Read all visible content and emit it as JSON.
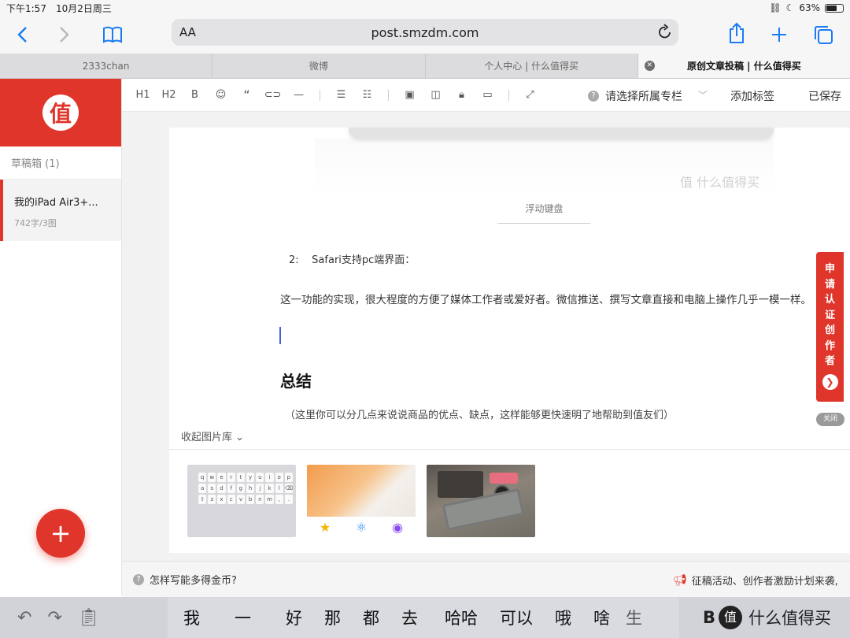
{
  "status_bar": {
    "time": "下午1:57",
    "date": "10月2日周三",
    "battery": "63%",
    "battery_level": 0.63
  },
  "browser": {
    "reader_label": "AA",
    "url": "post.smzdm.com",
    "tabs": [
      {
        "label": "2333chan"
      },
      {
        "label": "微博"
      },
      {
        "label": "个人中心 | 什么值得买"
      },
      {
        "label": "原创文章投稿 | 什么值得买"
      }
    ]
  },
  "sidebar": {
    "logo_char": "值",
    "drafts_label": "草稿箱 (1)",
    "draft": {
      "title": "我的iPad Air3+...",
      "meta": "742字/3图"
    },
    "add_label": "+"
  },
  "editor_toolbar": {
    "h1": "H1",
    "h2": "H2",
    "bold": "B",
    "quote": "“",
    "column_select": "请选择所属专栏",
    "add_tags": "添加标签",
    "saved": "已保存"
  },
  "article": {
    "watermark": "值 什么值得买",
    "image_caption": "浮动键盘",
    "item_heading": "2:    Safari支持pc端界面：",
    "paragraph": "这一功能的实现，很大程度的方便了媒体工作者或爱好者。微信推送、撰写文章直接和电脑上操作几乎一模一样。",
    "section_title": "总结",
    "placeholder": "（这里你可以分几点来说说商品的优点、缺点，这样能够更快速明了地帮助到值友们）"
  },
  "image_library": {
    "toggle_label": "收起图片库 ⌄"
  },
  "apply_banner": {
    "chars": [
      "申",
      "请",
      "认",
      "证",
      "创",
      "作",
      "者"
    ],
    "close_label": "关闭"
  },
  "hint_bar": {
    "question": "怎样写能多得金币?",
    "promo": "征稿活动、创作者激励计划来袭,"
  },
  "keyboard_bar": {
    "candidates": [
      "我",
      "一",
      "好",
      "那",
      "都",
      "去",
      "哈哈",
      "可以",
      "哦",
      "啥",
      "生"
    ],
    "right_text": "B",
    "brand_text": "什么值得买",
    "brand_char": "值"
  }
}
